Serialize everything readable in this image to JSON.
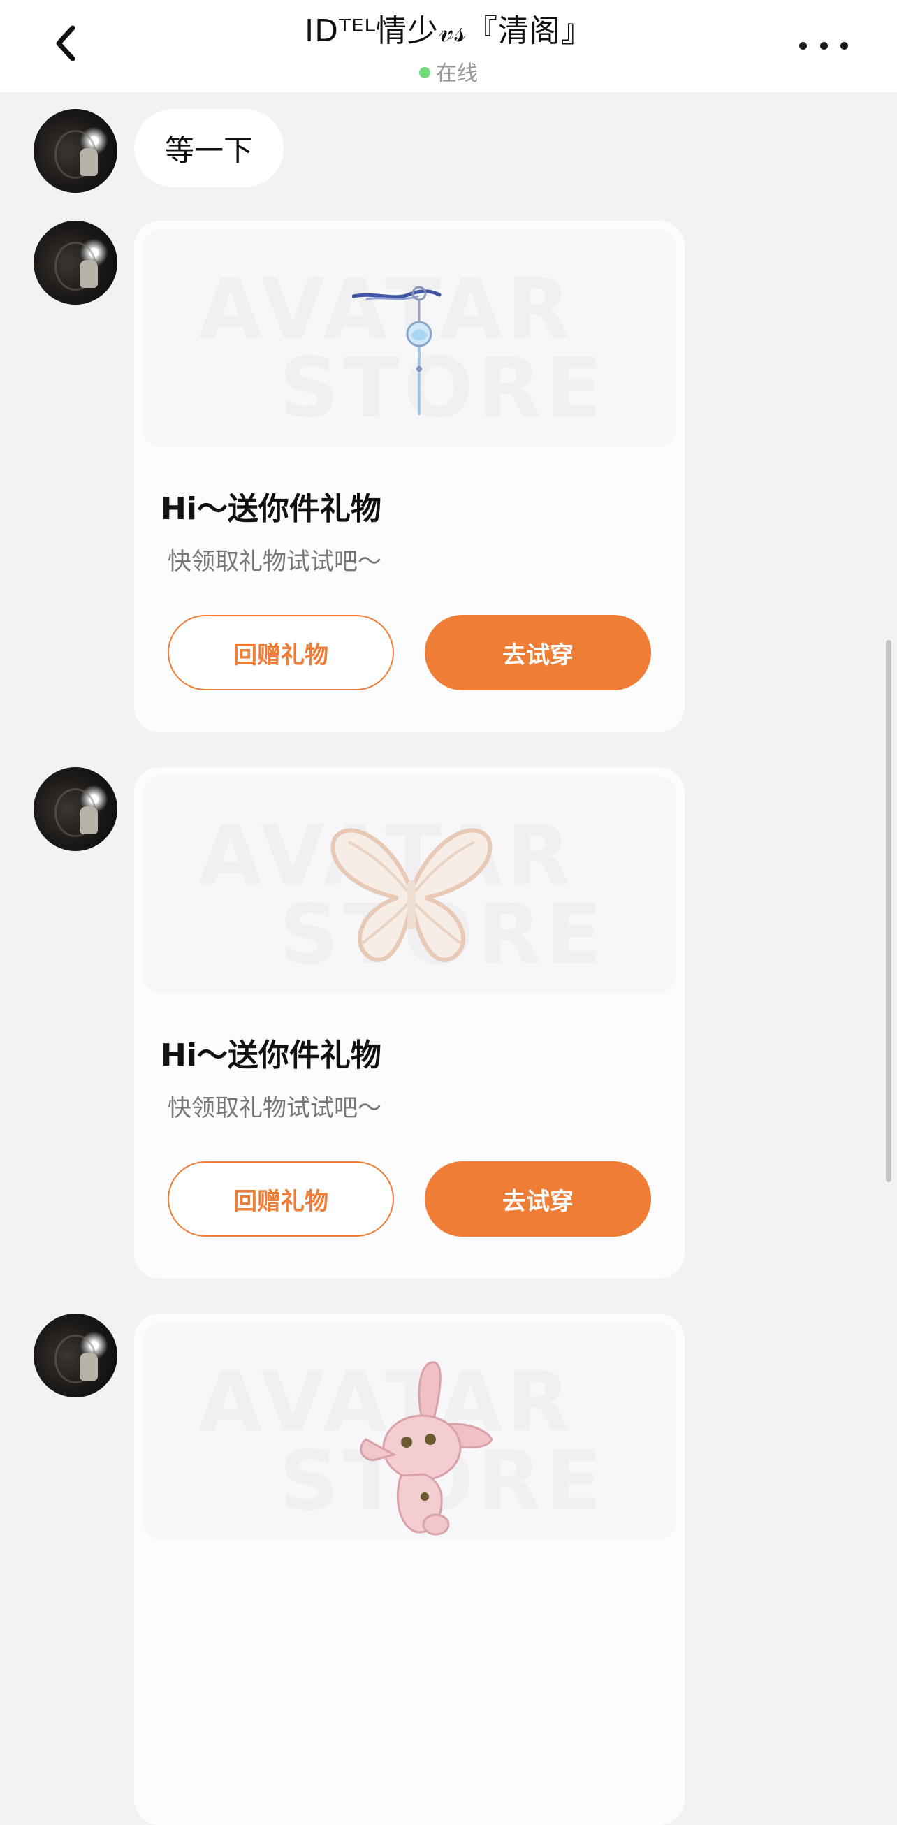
{
  "header": {
    "title": "IDᵀᴱᴸ情少𝓋𝓈『清阁』",
    "status": "在线"
  },
  "messages": {
    "text": "等一下",
    "gift_cards": [
      {
        "title": "Hi～送你件礼物",
        "subtitle": "快领取礼物试试吧～",
        "return_label": "回赠礼物",
        "try_label": "去试穿",
        "item_icon": "hairpin-tassel-icon"
      },
      {
        "title": "Hi～送你件礼物",
        "subtitle": "快领取礼物试试吧～",
        "return_label": "回赠礼物",
        "try_label": "去试穿",
        "item_icon": "butterfly-icon"
      },
      {
        "item_icon": "bunny-plush-icon"
      }
    ],
    "watermark_line1": "AVATAR",
    "watermark_line2": "STORE"
  },
  "colors": {
    "accent": "#ef7d36",
    "online": "#6fdb7a",
    "background": "#f2f2f5"
  }
}
